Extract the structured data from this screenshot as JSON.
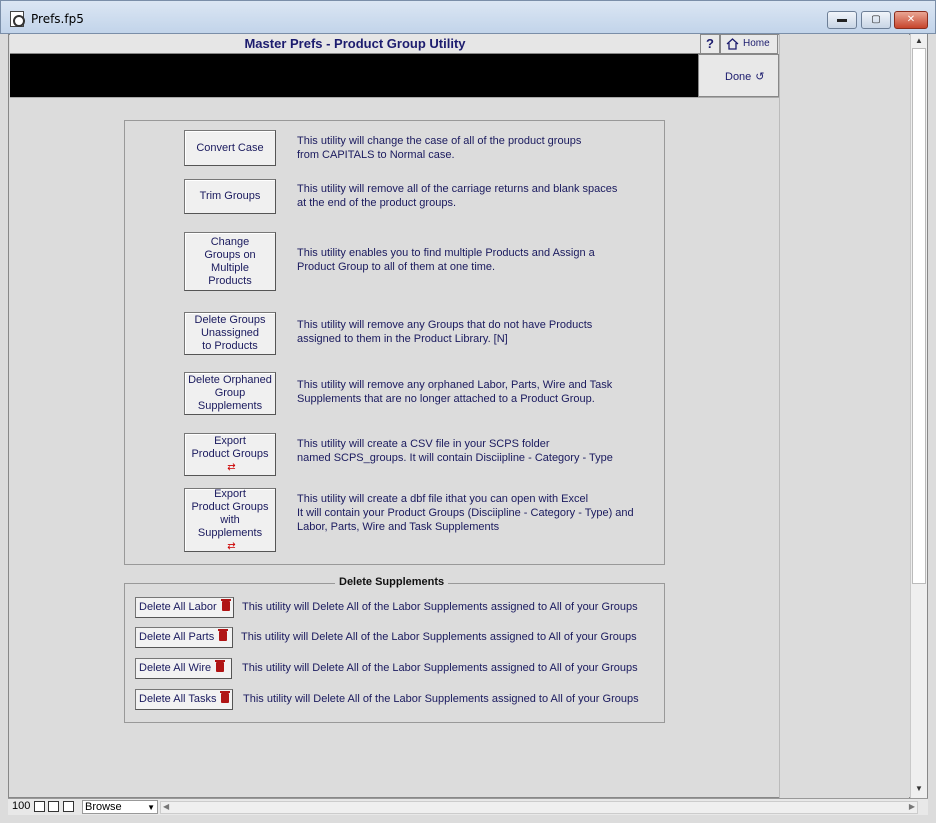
{
  "window": {
    "title": "Prefs.fp5",
    "minimize_glyph": "▬",
    "maximize_glyph": "▢",
    "close_glyph": "✕"
  },
  "header": {
    "title": "Master Prefs - Product Group Utility",
    "help_label": "?",
    "home_label": "Home",
    "done_label": "Done",
    "done_arrow": "↺"
  },
  "utilities": [
    {
      "label": "Convert Case",
      "desc": "This utility will change the case of all of the product groups\nfrom CAPITALS to Normal case."
    },
    {
      "label": "Trim Groups",
      "desc": "This utility will remove all of the carriage returns and blank spaces\nat the end of the product groups."
    },
    {
      "label": "Change\nGroups on\nMultiple\nProducts",
      "desc": "This utility enables you to find multiple Products and Assign a\nProduct Group to all of them at one time."
    },
    {
      "label": "Delete Groups\nUnassigned\nto Products",
      "desc": "This utility will remove any Groups that do not have Products\nassigned to them in the Product Library.  [N]"
    },
    {
      "label": "Delete Orphaned\nGroup\nSupplements",
      "desc": "This utility will remove any orphaned Labor, Parts, Wire and Task\nSupplements that are no longer attached to a Product Group."
    },
    {
      "label": "Export\nProduct Groups",
      "desc": "This utility will  create a CSV file in your SCPS folder\nnamed SCPS_groups.  It will contain Disciipline - Category - Type"
    },
    {
      "label": "Export\nProduct Groups\nwith\nSupplements",
      "desc": "This utility will  create a dbf file ithat you can open with Excel\nIt will contain your Product Groups (Disciipline - Category - Type) and\nLabor, Parts, Wire and Task Supplements"
    }
  ],
  "delete_supplements": {
    "title": "Delete Supplements",
    "items": [
      {
        "label": "Delete All Labor",
        "desc": "This utility will Delete All of the Labor Supplements assigned to All of your Groups"
      },
      {
        "label": "Delete All Parts",
        "desc": "This utility will Delete All of the Labor Supplements assigned to All of your Groups"
      },
      {
        "label": "Delete All Wire",
        "desc": "This utility will Delete All of the Labor Supplements assigned to All of your Groups"
      },
      {
        "label": "Delete All Tasks",
        "desc": "This utility will Delete All of the Labor Supplements assigned to All of your Groups"
      }
    ]
  },
  "statusbar": {
    "zoom": "100",
    "mode": "Browse"
  }
}
